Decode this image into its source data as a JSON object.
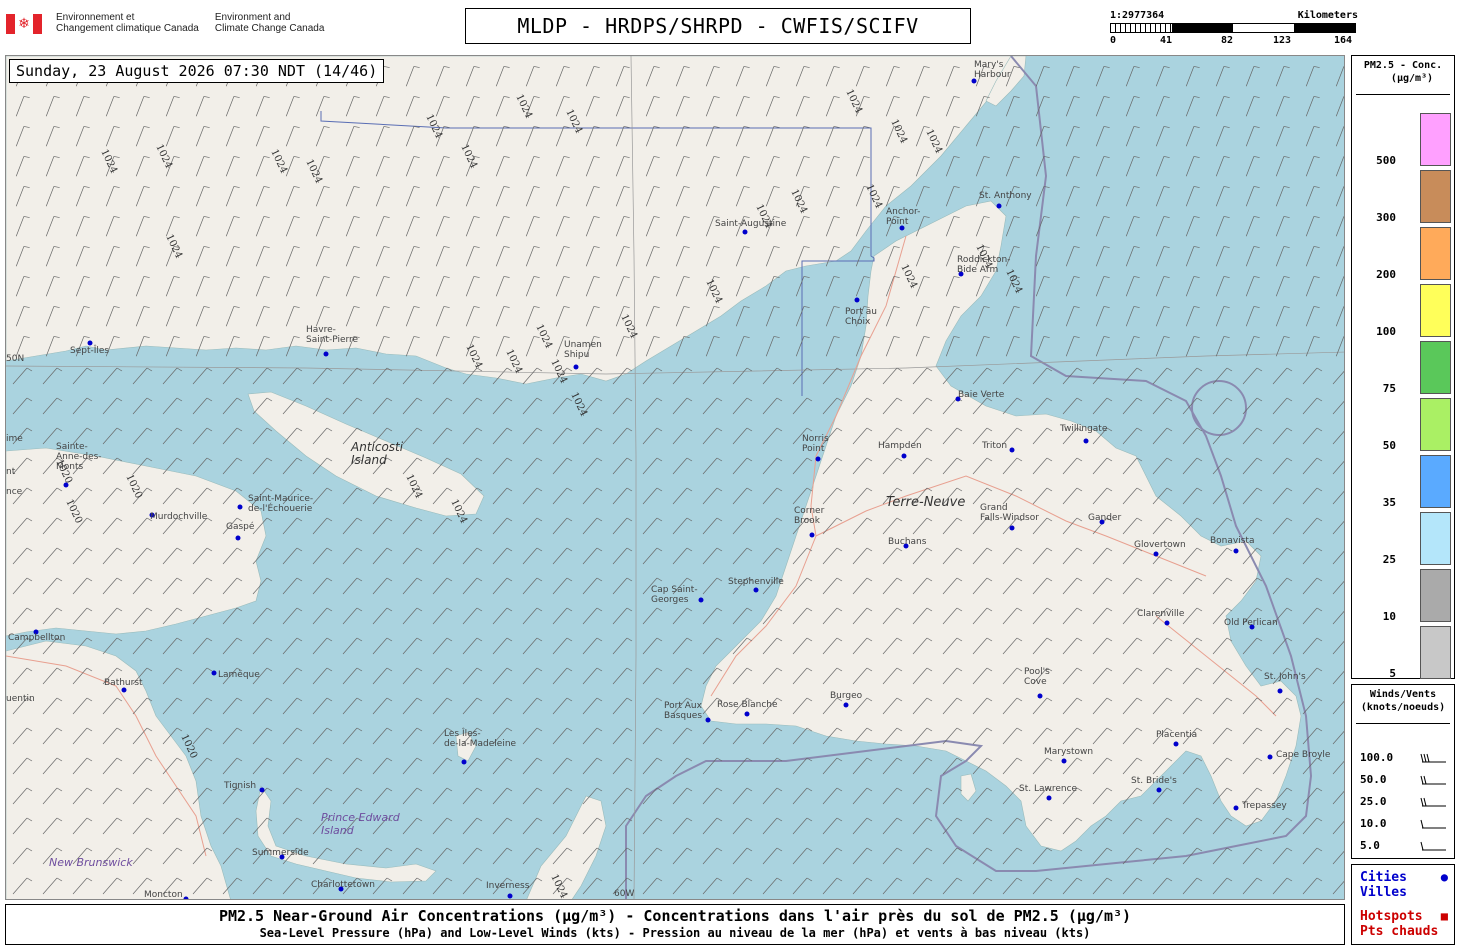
{
  "header": {
    "dept_fr": [
      "Environnement et",
      "Changement climatique Canada"
    ],
    "dept_en": [
      "Environment and",
      "Climate Change Canada"
    ],
    "title": "MLDP - HRDPS/SHRPD - CWFIS/SCIFV"
  },
  "scale": {
    "ratio": "1:2977364",
    "unit": "Kilometers",
    "ticks": [
      "0",
      "41",
      "82",
      "123",
      "164"
    ]
  },
  "timestamp": "Sunday, 23 August 2026 07:30 NDT (14/46)",
  "map": {
    "cities": [
      {
        "name": "Mary's Harbour",
        "lines": [
          "Mary's",
          "Harbour"
        ]
      },
      {
        "name": "St. Anthony",
        "lines": [
          "St. Anthony"
        ]
      },
      {
        "name": "Anchor-Point",
        "lines": [
          "Anchor-",
          "Point"
        ]
      },
      {
        "name": "Saint-Augustine",
        "lines": [
          "Saint-Augustine"
        ]
      },
      {
        "name": "Roddickton-Bide Arm",
        "lines": [
          "Roddickton-",
          "Bide Arm"
        ]
      },
      {
        "name": "Port au Choix",
        "lines": [
          "Port au",
          "Choix"
        ]
      },
      {
        "name": "Sept-Îles",
        "lines": [
          "Sept-Îles"
        ]
      },
      {
        "name": "Havre-Saint-Pierre",
        "lines": [
          "Havre-",
          "Saint-Pierre"
        ]
      },
      {
        "name": "Unamen Shipu",
        "lines": [
          "Unamen",
          "Shipu"
        ]
      },
      {
        "name": "Baie Verte",
        "lines": [
          "Baie Verte"
        ]
      },
      {
        "name": "Twillingate",
        "lines": [
          "Twillingate"
        ]
      },
      {
        "name": "Norris Point",
        "lines": [
          "Norris",
          "Point"
        ]
      },
      {
        "name": "Hampden",
        "lines": [
          "Hampden"
        ]
      },
      {
        "name": "Triton",
        "lines": [
          "Triton"
        ]
      },
      {
        "name": "Sainte-Anne-des-Monts",
        "lines": [
          "Sainte-",
          "Anne-des-",
          "Monts"
        ]
      },
      {
        "name": "Saint-Maurice-de-l'Échouerie",
        "lines": [
          "Saint-Maurice-",
          "de-l'Échouerie"
        ]
      },
      {
        "name": "Murdochville",
        "lines": [
          "Murdochville"
        ]
      },
      {
        "name": "Gaspé",
        "lines": [
          "Gaspé"
        ]
      },
      {
        "name": "Corner Brook",
        "lines": [
          "Corner",
          "Brook"
        ]
      },
      {
        "name": "Grand Falls-Windsor",
        "lines": [
          "Grand",
          "Falls-Windsor"
        ]
      },
      {
        "name": "Gander",
        "lines": [
          "Gander"
        ]
      },
      {
        "name": "Buchans",
        "lines": [
          "Buchans"
        ]
      },
      {
        "name": "Glovertown",
        "lines": [
          "Glovertown"
        ]
      },
      {
        "name": "Bonavista",
        "lines": [
          "Bonavista"
        ]
      },
      {
        "name": "Cap Saint-Georges",
        "lines": [
          "Cap Saint-",
          "Georges"
        ]
      },
      {
        "name": "Stephenville",
        "lines": [
          "Stephenville"
        ]
      },
      {
        "name": "Campbellton",
        "lines": [
          "Campbellton"
        ]
      },
      {
        "name": "Clarenville",
        "lines": [
          "Clarenville"
        ]
      },
      {
        "name": "Old Perlican",
        "lines": [
          "Old Perlican"
        ]
      },
      {
        "name": "Bathurst",
        "lines": [
          "Bathurst"
        ]
      },
      {
        "name": "Lamèque",
        "lines": [
          "Lamèque"
        ]
      },
      {
        "name": "Pool's Cove",
        "lines": [
          "Pool's",
          "Cove"
        ]
      },
      {
        "name": "St. John's",
        "lines": [
          "St. John's"
        ]
      },
      {
        "name": "Port Aux Basques",
        "lines": [
          "Port Aux",
          "Basques"
        ]
      },
      {
        "name": "Rose Blanche",
        "lines": [
          "Rose Blanche"
        ]
      },
      {
        "name": "Burgeo",
        "lines": [
          "Burgeo"
        ]
      },
      {
        "name": "Placentia",
        "lines": [
          "Placentia"
        ]
      },
      {
        "name": "Les Îles-de-la-Madeleine",
        "lines": [
          "Les Îles-",
          "de-la-Madeleine"
        ]
      },
      {
        "name": "Marystown",
        "lines": [
          "Marystown"
        ]
      },
      {
        "name": "Cape Broyle",
        "lines": [
          "Cape Broyle"
        ]
      },
      {
        "name": "Tignish",
        "lines": [
          "Tignish"
        ]
      },
      {
        "name": "St. Bride's",
        "lines": [
          "St. Bride's"
        ]
      },
      {
        "name": "St. Lawrence",
        "lines": [
          "St. Lawrence"
        ]
      },
      {
        "name": "Trepassey",
        "lines": [
          "Trepassey"
        ]
      },
      {
        "name": "Summerside",
        "lines": [
          "Summerside"
        ]
      },
      {
        "name": "Charlottetown",
        "lines": [
          "Charlottetown"
        ]
      },
      {
        "name": "Inverness",
        "lines": [
          "Inverness"
        ]
      },
      {
        "name": "Moncton",
        "lines": [
          "Moncton"
        ]
      }
    ],
    "regions": [
      {
        "name": "Anticosti Island",
        "lines": [
          "Anticosti",
          "Island"
        ]
      },
      {
        "name": "Terre-Neuve",
        "lines": [
          "Terre-Neuve"
        ]
      },
      {
        "name": "Prince Edward Island",
        "lines": [
          "Prince Edward",
          "Island"
        ]
      },
      {
        "name": "New Brunswick",
        "lines": [
          "New Brunswick"
        ]
      }
    ],
    "partial_labels": [
      "ime",
      "nt",
      "nce",
      "uentin",
      "50N",
      "60W"
    ],
    "isobar_labels": [
      "1024",
      "1020"
    ]
  },
  "legend_pm": {
    "title_lines": [
      "PM2.5 - Conc.",
      "(µg/m³)"
    ],
    "levels": [
      {
        "value": "500",
        "color": "#ffa0ff"
      },
      {
        "value": "300",
        "color": "#c88c5a"
      },
      {
        "value": "200",
        "color": "#ffaa5a"
      },
      {
        "value": "100",
        "color": "#ffff5a"
      },
      {
        "value": "75",
        "color": "#5ac85a"
      },
      {
        "value": "50",
        "color": "#aaf064"
      },
      {
        "value": "35",
        "color": "#5aaaff"
      },
      {
        "value": "25",
        "color": "#b4e6fa"
      },
      {
        "value": "10",
        "color": "#aaaaaa"
      },
      {
        "value": "5",
        "color": "#c8c8c8"
      }
    ]
  },
  "legend_wind": {
    "title_lines": [
      "Winds/Vents",
      "(knots/noeuds)"
    ],
    "speeds": [
      "100.0",
      "50.0",
      "25.0",
      "10.0",
      "5.0"
    ]
  },
  "legend_points": {
    "cities": [
      "Cities",
      "Villes"
    ],
    "hotspots": [
      "Hotspots",
      "Pts chauds"
    ],
    "cities_color": "#0000cc",
    "hotspots_color": "#cc0000"
  },
  "caption": {
    "line1": "PM2.5 Near-Ground Air Concentrations (µg/m³) - Concentrations dans l'air près du sol de PM2.5 (µg/m³)",
    "line2": "Sea-Level Pressure (hPa) and Low-Level Winds (kts) - Pression au niveau de la mer (hPa) et vents à bas niveau (kts)"
  },
  "colors": {
    "water": "#aad3df",
    "land": "#f2efe9",
    "city_dot": "#0000cc",
    "border": "#5a6eb4"
  }
}
